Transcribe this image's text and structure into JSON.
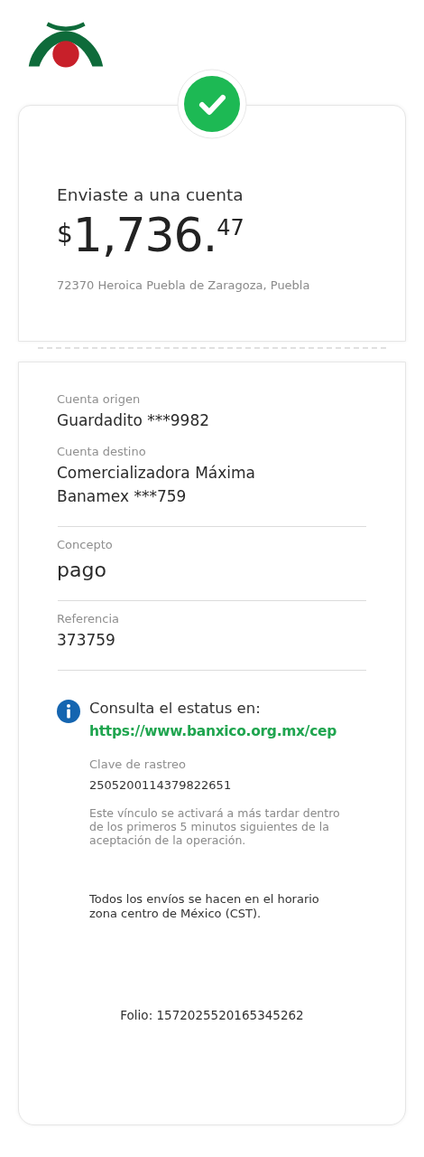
{
  "header": {
    "title": "Enviaste a una cuenta",
    "amount": {
      "currency": "$",
      "integer": "1,736.",
      "cents": "47"
    },
    "address": "72370 Heroica Puebla de Zaragoza, Puebla"
  },
  "sections": [
    {
      "fields": [
        {
          "label": "Cuenta origen",
          "value": "Guardadito ***9982",
          "kind": "normal"
        },
        {
          "label": "Cuenta destino",
          "value": "Comercializadora Máxima Banamex ***759",
          "kind": "normal"
        }
      ]
    },
    {
      "fields": [
        {
          "label": "Concepto",
          "value": "pago",
          "kind": "large"
        }
      ]
    },
    {
      "fields": [
        {
          "label": "Referencia",
          "value": "373759",
          "kind": "normal"
        }
      ]
    }
  ],
  "info": {
    "title": "Consulta el estatus en:",
    "link": "https://www.banxico.org.mx/cep",
    "tracking_label": "Clave de rastreo",
    "tracking_value": "2505200114379822651",
    "note": "Este vínculo se activará a más tardar dentro de los primeros 5 minutos siguientes de la aceptación de la operación."
  },
  "schedule_note": "Todos los envíos se hacen en el horario zona centro de México (CST).",
  "folio": "Folio: 1572025520165345262"
}
